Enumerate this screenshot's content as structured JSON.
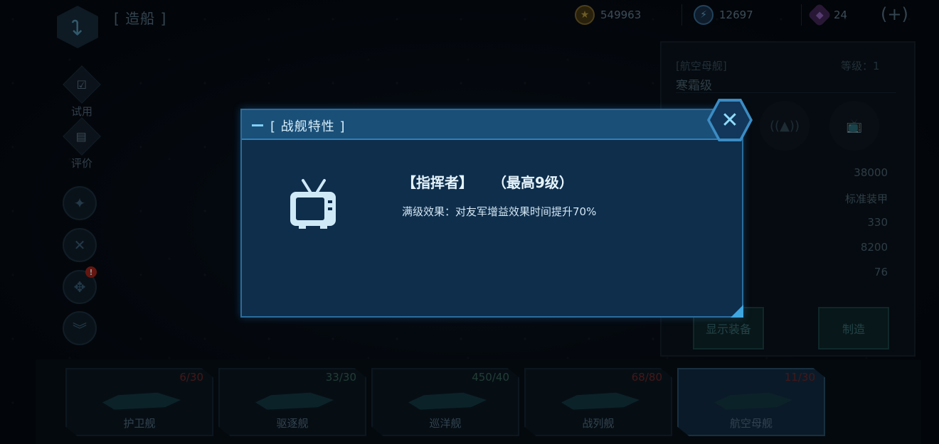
{
  "header": {
    "page_title": "[ 造船 ]",
    "gold": "549963",
    "energy": "12697",
    "crystal": "24",
    "add_symbol": "(+)"
  },
  "sidebar": {
    "trial_label": "试用",
    "review_label": "评价",
    "alert_badge": "!"
  },
  "ship_panel": {
    "category": "[航空母舰]",
    "name": "寒霜级",
    "level_label": "等级：1",
    "stats": [
      "38000",
      "标准装甲",
      "330",
      "8200",
      "76"
    ],
    "show_equipment_label": "显示装备",
    "build_label": "制造"
  },
  "ship_tabs": [
    {
      "label": "护卫舰",
      "count": "6/30",
      "selected": false
    },
    {
      "label": "驱逐舰",
      "count": "33/30",
      "selected": false
    },
    {
      "label": "巡洋舰",
      "count": "450/40",
      "selected": false
    },
    {
      "label": "战列舰",
      "count": "68/80",
      "selected": false
    },
    {
      "label": "航空母舰",
      "count": "11/30",
      "selected": true
    }
  ],
  "modal": {
    "title": "[ 战舰特性 ]",
    "trait_name": "【指挥者】",
    "trait_max": "（最高9级）",
    "trait_desc": "满级效果：对友军增益效果时间提升70%",
    "close_symbol": "✕"
  }
}
